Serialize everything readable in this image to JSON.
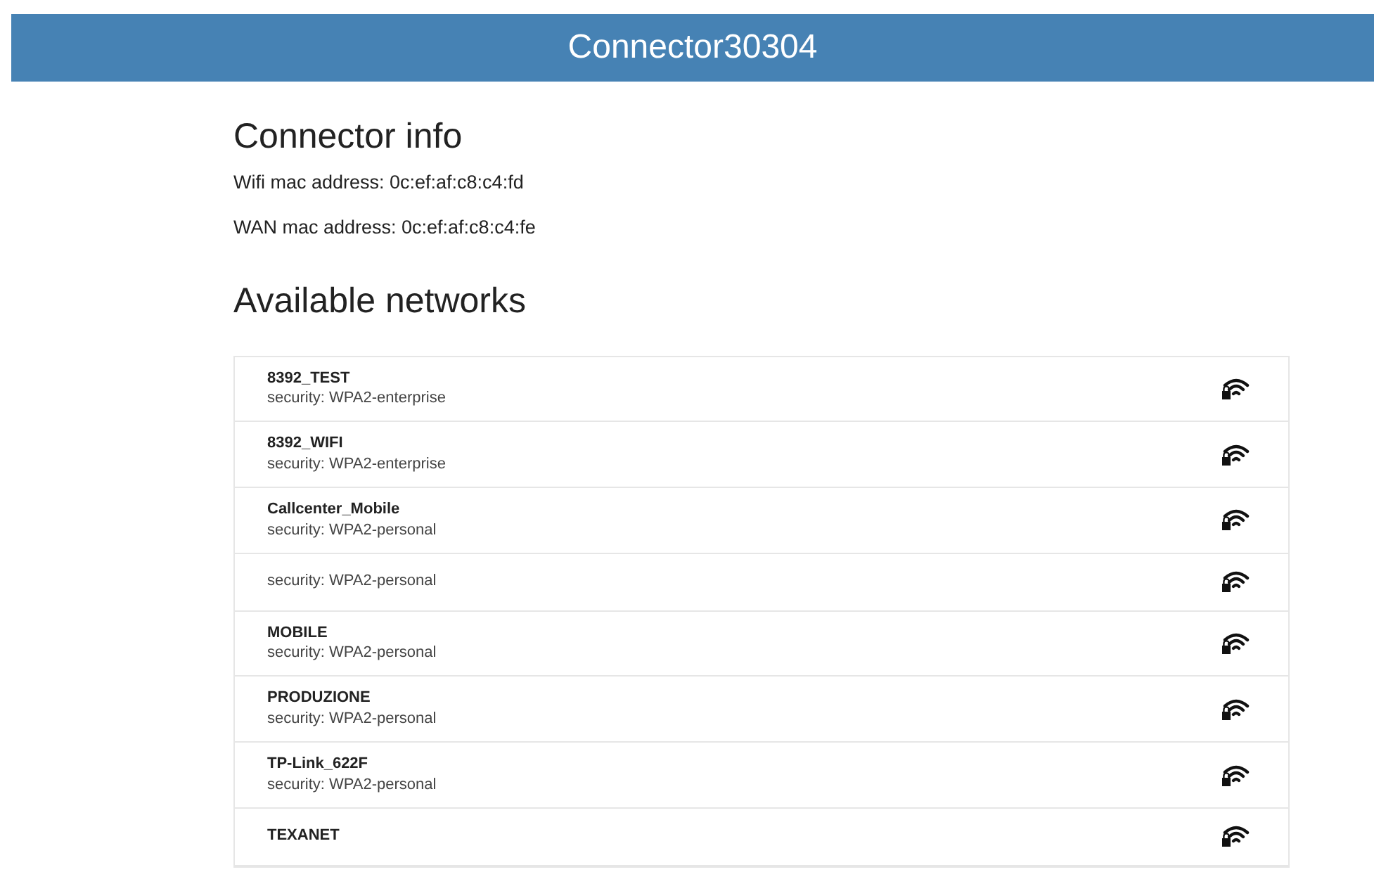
{
  "header": {
    "title": "Connector30304"
  },
  "connector_info": {
    "heading": "Connector info",
    "lines": [
      "Wifi mac address: 0c:ef:af:c8:c4:fd",
      "WAN mac address: 0c:ef:af:c8:c4:fe"
    ]
  },
  "networks": {
    "heading": "Available networks",
    "items": [
      {
        "name": "8392_TEST",
        "security": "security: WPA2-enterprise"
      },
      {
        "name": "8392_WIFI",
        "security": "security: WPA2-enterprise"
      },
      {
        "name": "Callcenter_Mobile",
        "security": "security: WPA2-personal"
      },
      {
        "security": "security: WPA2-personal"
      },
      {
        "name": "MOBILE",
        "security": "security: WPA2-personal"
      },
      {
        "name": "PRODUZIONE",
        "security": "security: WPA2-personal"
      },
      {
        "name": "TP-Link_622F",
        "security": "security: WPA2-personal"
      },
      {
        "name": "TEXANET"
      }
    ]
  }
}
